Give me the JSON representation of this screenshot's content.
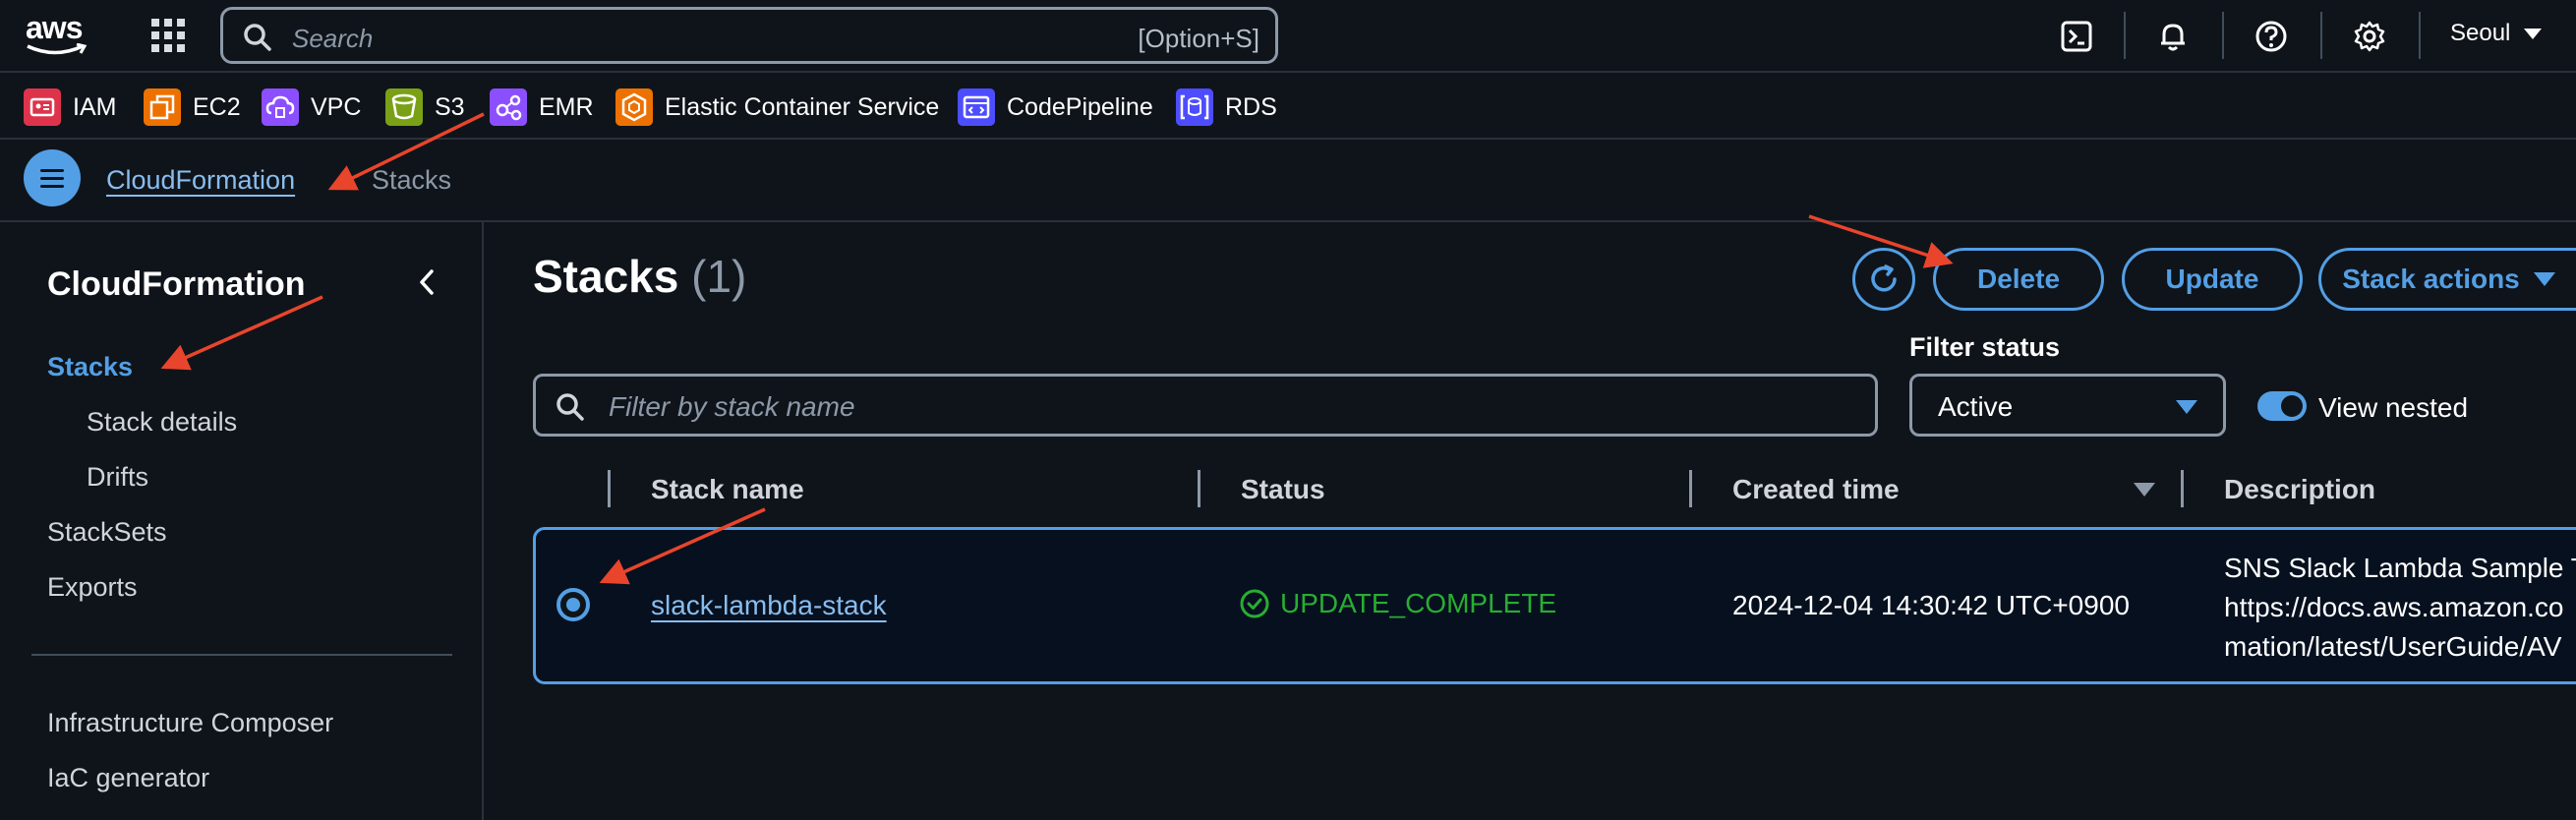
{
  "topbar": {
    "logo_text": "aws",
    "search_placeholder": "Search",
    "search_shortcut": "[Option+S]",
    "icons": [
      "cloudshell-icon",
      "bell-icon",
      "help-icon",
      "gear-icon"
    ],
    "region": "Seoul"
  },
  "favorites": [
    {
      "label": "IAM",
      "color": "#dd344c"
    },
    {
      "label": "EC2",
      "color": "#ed7100"
    },
    {
      "label": "VPC",
      "color": "#8c4fff"
    },
    {
      "label": "S3",
      "color": "#7aa116"
    },
    {
      "label": "EMR",
      "color": "#8c4fff"
    },
    {
      "label": "Elastic Container Service",
      "color": "#ed7100"
    },
    {
      "label": "CodePipeline",
      "color": "#4d4dff"
    },
    {
      "label": "RDS",
      "color": "#4d4dff"
    }
  ],
  "breadcrumb": {
    "service": "CloudFormation",
    "current": "Stacks"
  },
  "sidenav": {
    "title": "CloudFormation",
    "items": [
      {
        "label": "Stacks",
        "active": true
      },
      {
        "label": "Stack details",
        "active": false
      },
      {
        "label": "Drifts",
        "active": false
      },
      {
        "label": "StackSets",
        "active": false
      },
      {
        "label": "Exports",
        "active": false
      }
    ],
    "extra": [
      {
        "label": "Infrastructure Composer"
      },
      {
        "label": "IaC generator"
      }
    ]
  },
  "main": {
    "heading": "Stacks",
    "count": "(1)",
    "buttons": {
      "delete": "Delete",
      "update": "Update",
      "stack_actions": "Stack actions"
    },
    "filter": {
      "placeholder": "Filter by stack name",
      "status_label": "Filter status",
      "status_value": "Active",
      "view_nested_label": "View nested",
      "view_nested_on": true
    },
    "table": {
      "columns": [
        "Stack name",
        "Status",
        "Created time",
        "Description"
      ],
      "rows": [
        {
          "selected": true,
          "stack_name": "slack-lambda-stack",
          "status": "UPDATE_COMPLETE",
          "created": "2024-12-04 14:30:42 UTC+0900",
          "description_lines": [
            "SNS Slack Lambda Sample T",
            "https://docs.aws.amazon.co",
            "mation/latest/UserGuide/AV"
          ]
        }
      ]
    }
  },
  "colors": {
    "background": "#0f141a",
    "accent": "#539fe5",
    "link": "#89bdee",
    "success": "#29ad32",
    "annotation_arrow": "#e8452c"
  }
}
